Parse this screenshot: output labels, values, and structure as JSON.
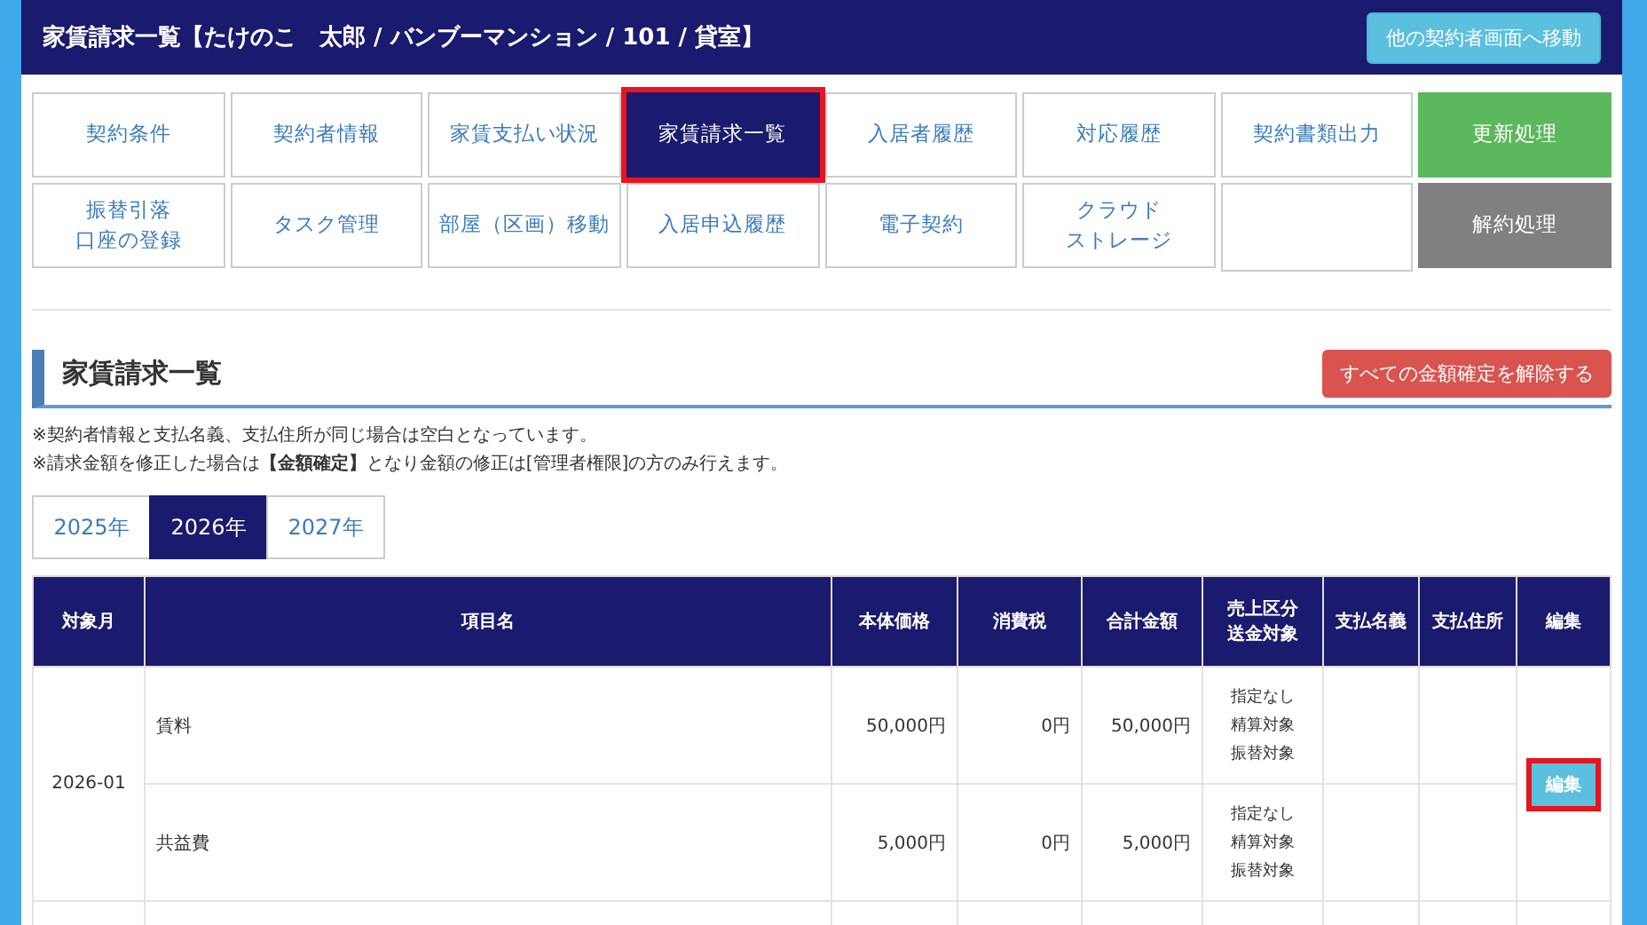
{
  "header": {
    "title": "家賃請求一覧【たけのこ　太郎 / バンブーマンション / 101 / 貸室】",
    "button": "他の契約者画面へ移動"
  },
  "nav_tabs": [
    {
      "label": "契約条件",
      "kind": "normal",
      "selected": false
    },
    {
      "label": "契約者情報",
      "kind": "normal",
      "selected": false
    },
    {
      "label": "家賃支払い状況",
      "kind": "normal",
      "selected": false
    },
    {
      "label": "家賃請求一覧",
      "kind": "normal",
      "selected": true,
      "highlighted": true
    },
    {
      "label": "入居者履歴",
      "kind": "normal",
      "selected": false
    },
    {
      "label": "対応履歴",
      "kind": "normal",
      "selected": false
    },
    {
      "label": "契約書類出力",
      "kind": "normal",
      "selected": false
    },
    {
      "label": "更新処理",
      "kind": "green",
      "selected": false
    },
    {
      "lines": [
        "振替引落",
        "口座の登録"
      ],
      "kind": "normal",
      "selected": false
    },
    {
      "label": "タスク管理",
      "kind": "normal",
      "selected": false
    },
    {
      "label": "部屋（区画）移動",
      "kind": "normal",
      "selected": false
    },
    {
      "label": "入居申込履歴",
      "kind": "normal",
      "selected": false
    },
    {
      "label": "電子契約",
      "kind": "normal",
      "selected": false
    },
    {
      "lines": [
        "クラウド",
        "ストレージ"
      ],
      "kind": "normal",
      "selected": false
    },
    {
      "kind": "empty"
    },
    {
      "label": "解約処理",
      "kind": "grey",
      "selected": false
    }
  ],
  "section": {
    "title": "家賃請求一覧",
    "button": "すべての金額確定を解除する"
  },
  "notes": [
    "※契約者情報と支払名義、支払住所が同じ場合は空白となっています。",
    "※請求金額を修正した場合は**【金額確定】**となり金額の修正は[管理者権限]の方のみ行えます。"
  ],
  "year_tabs": [
    {
      "label": "2025年",
      "selected": false
    },
    {
      "label": "2026年",
      "selected": true
    },
    {
      "label": "2027年",
      "selected": false
    }
  ],
  "table": {
    "columns": [
      "対象月",
      "項目名",
      "本体価格",
      "消費税",
      "合計金額",
      [
        "売上区分",
        "送金対象"
      ],
      "支払名義",
      "支払住所",
      "編集"
    ],
    "groups": [
      {
        "month": "2026-01",
        "edit": "編集",
        "edit_highlighted": true,
        "items": [
          {
            "name": "賃料",
            "price": "50,000円",
            "tax": "0円",
            "total": "50,000円",
            "flags": [
              "指定なし",
              "精算対象",
              "振替対象"
            ]
          },
          {
            "name": "共益費",
            "price": "5,000円",
            "tax": "0円",
            "total": "5,000円",
            "flags": [
              "指定なし",
              "精算対象",
              "振替対象"
            ]
          }
        ]
      }
    ]
  }
}
